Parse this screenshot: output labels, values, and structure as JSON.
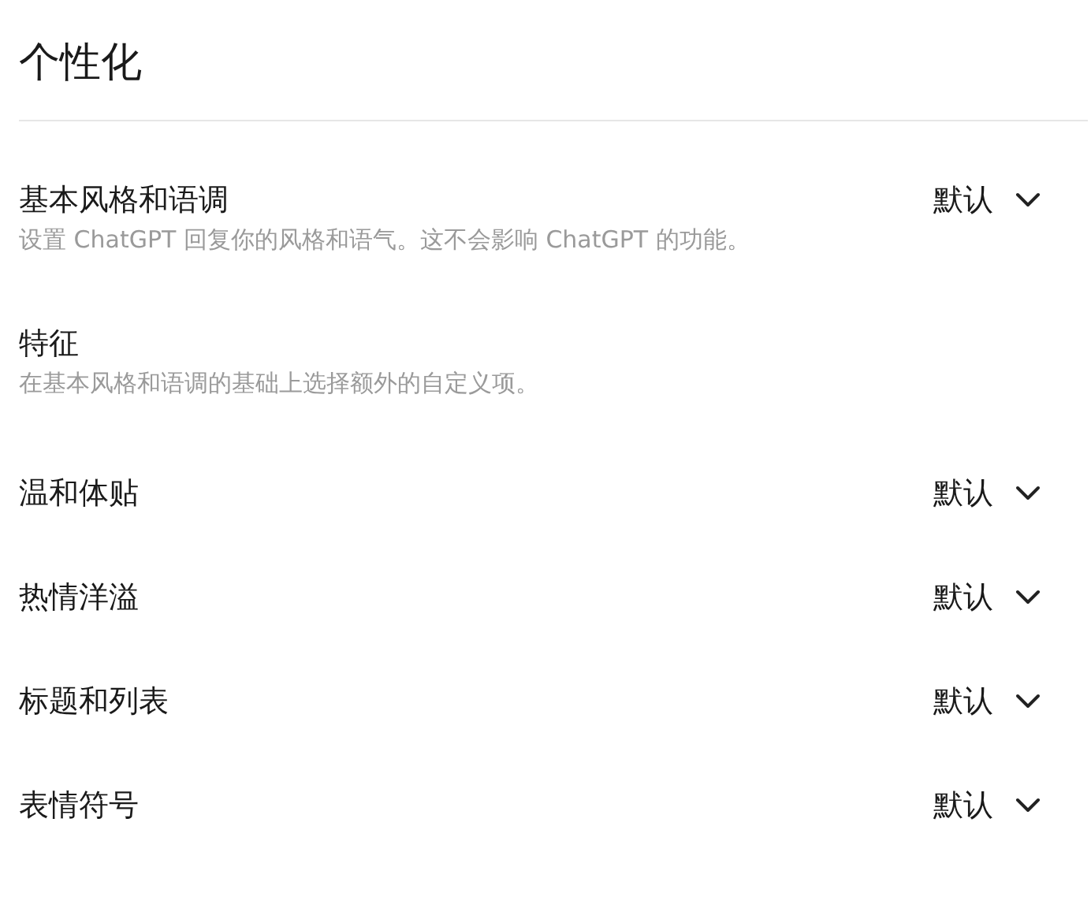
{
  "title": "个性化",
  "settings": [
    {
      "kind": "select",
      "label": "基本风格和语调",
      "description": "设置 ChatGPT 回复你的风格和语气。这不会影响 ChatGPT 的功能。",
      "value": "默认"
    },
    {
      "kind": "heading",
      "label": "特征",
      "description": "在基本风格和语调的基础上选择额外的自定义项。"
    },
    {
      "kind": "select",
      "label": "温和体贴",
      "value": "默认"
    },
    {
      "kind": "select",
      "label": "热情洋溢",
      "value": "默认"
    },
    {
      "kind": "select",
      "label": "标题和列表",
      "value": "默认"
    },
    {
      "kind": "select",
      "label": "表情符号",
      "value": "默认"
    }
  ]
}
